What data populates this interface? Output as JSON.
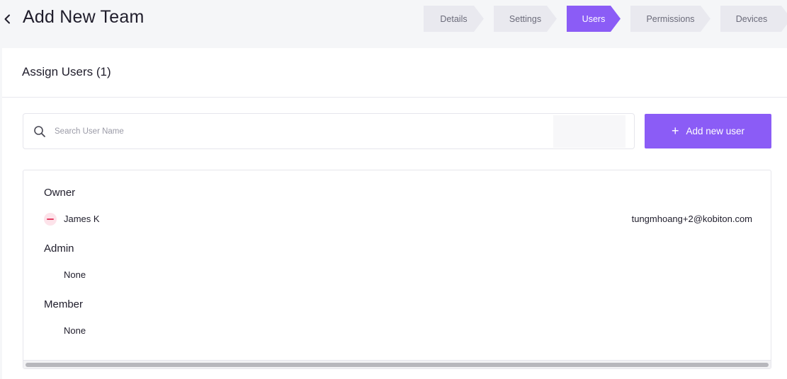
{
  "header": {
    "title": "Add New Team",
    "back_icon": "chevron-left-icon"
  },
  "steps": [
    {
      "label": "Details",
      "active": false
    },
    {
      "label": "Settings",
      "active": false
    },
    {
      "label": "Users",
      "active": true
    },
    {
      "label": "Permissions",
      "active": false
    },
    {
      "label": "Devices",
      "active": false
    }
  ],
  "section": {
    "title": "Assign Users (1)"
  },
  "search": {
    "placeholder": "Search User Name",
    "value": "",
    "icon": "search-icon"
  },
  "add_button": {
    "label": "Add new user",
    "icon": "plus-icon"
  },
  "roles": {
    "owner": {
      "label": "Owner",
      "users": [
        {
          "name": "James K",
          "email": "tungmhoang+2@kobiton.com",
          "icon": "remove-icon"
        }
      ]
    },
    "admin": {
      "label": "Admin",
      "empty_text": "None"
    },
    "member": {
      "label": "Member",
      "empty_text": "None"
    }
  },
  "colors": {
    "accent": "#8b5cf6",
    "step_inactive": "#e9e9ef",
    "remove": "#e43d63",
    "background": "#f5f6f8"
  }
}
